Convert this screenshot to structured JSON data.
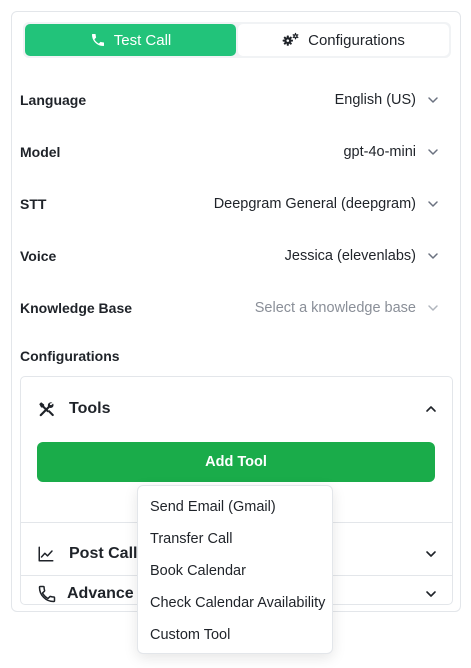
{
  "tabs": {
    "test_call": "Test Call",
    "configurations": "Configurations",
    "active": "test_call"
  },
  "settings": [
    {
      "label": "Language",
      "value": "English (US)",
      "placeholder": false
    },
    {
      "label": "Model",
      "value": "gpt-4o-mini",
      "placeholder": false
    },
    {
      "label": "STT",
      "value": "Deepgram General (deepgram)",
      "placeholder": false
    },
    {
      "label": "Voice",
      "value": "Jessica (elevenlabs)",
      "placeholder": false
    },
    {
      "label": "Knowledge Base",
      "value": "Select a knowledge base",
      "placeholder": true
    }
  ],
  "configurations": {
    "title": "Configurations",
    "sections": [
      {
        "title": "Tools",
        "icon": "tools-icon",
        "expanded": true
      },
      {
        "title": "Post Call",
        "icon": "chart-line-icon",
        "expanded": false
      },
      {
        "title": "Advance S",
        "icon": "phone-icon",
        "expanded": false
      }
    ],
    "add_tool_label": "Add Tool"
  },
  "tool_menu": {
    "items": [
      "Send Email (Gmail)",
      "Transfer Call",
      "Book Calendar",
      "Check Calendar Availability",
      "Custom Tool"
    ]
  },
  "colors": {
    "tab_active": "#22c37a",
    "add_tool_button": "#1aac4a",
    "border": "#e3e6ea",
    "placeholder_text": "#8a8f98"
  }
}
